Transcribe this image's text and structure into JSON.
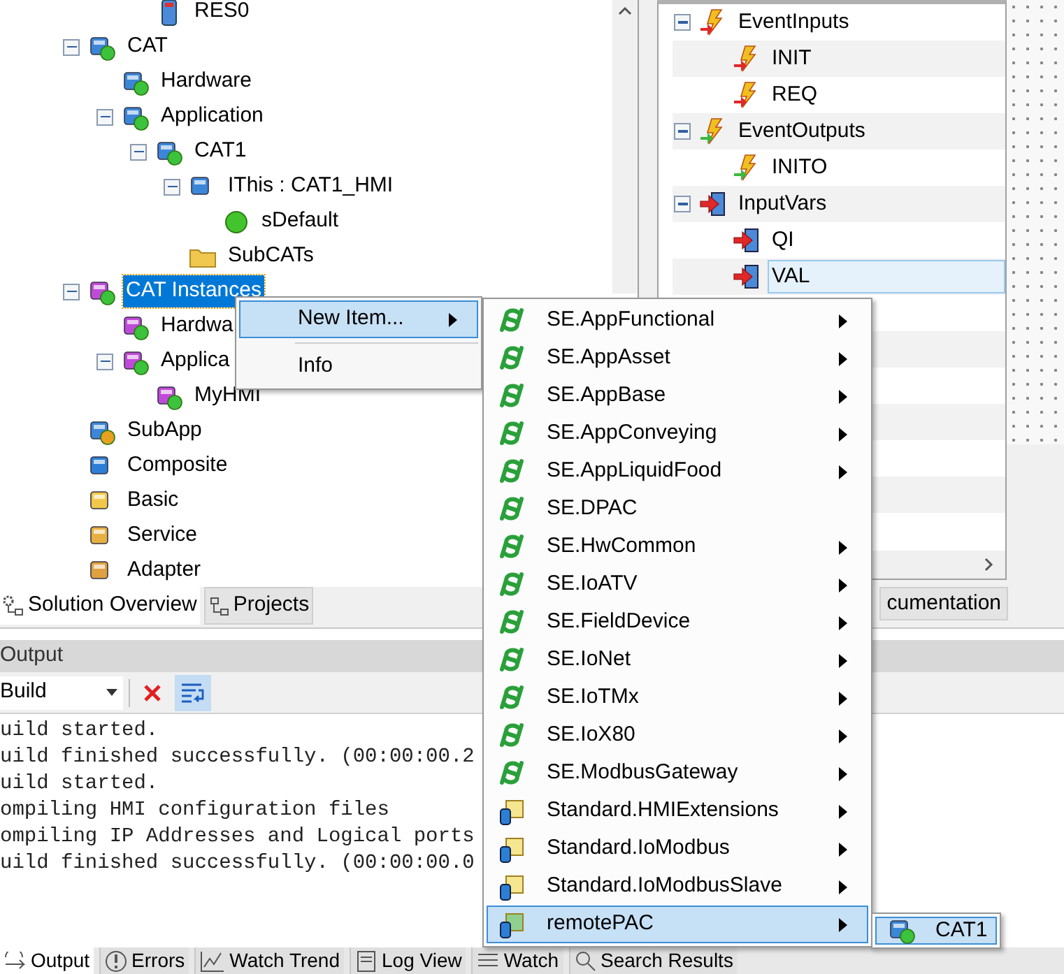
{
  "solution_tree": {
    "scrolled_branch": [
      {
        "label": "RES0",
        "kind": "resource",
        "selected": false
      }
    ],
    "items": [
      {
        "label": "CAT",
        "kind": "cat",
        "expanded": true,
        "selected": false,
        "children": [
          {
            "label": "Hardware",
            "kind": "cat",
            "selected": false
          },
          {
            "label": "Application",
            "kind": "cat",
            "expanded": true,
            "selected": false,
            "children": [
              {
                "label": "CAT1",
                "kind": "cat",
                "expanded": true,
                "selected": false,
                "children": [
                  {
                    "label": "IThis : CAT1_HMI",
                    "kind": "interface",
                    "expanded": true,
                    "selected": false,
                    "children": [
                      {
                        "label": "sDefault",
                        "kind": "module",
                        "selected": false
                      }
                    ]
                  },
                  {
                    "label": "SubCATs",
                    "kind": "folder",
                    "selected": false
                  }
                ]
              }
            ]
          }
        ]
      },
      {
        "label": "CAT Instances",
        "kind": "cat-instance",
        "expanded": true,
        "selected": true,
        "children": [
          {
            "label": "Hardwa",
            "kind": "cat-instance",
            "selected": false
          },
          {
            "label": "Applica",
            "kind": "cat-instance",
            "expanded": true,
            "selected": false,
            "children": [
              {
                "label": "MyHMI",
                "kind": "cat-instance",
                "selected": false
              }
            ]
          }
        ]
      },
      {
        "label": "SubApp",
        "kind": "subapp",
        "selected": false
      },
      {
        "label": "Composite",
        "kind": "composite",
        "selected": false
      },
      {
        "label": "Basic",
        "kind": "basic",
        "selected": false
      },
      {
        "label": "Service",
        "kind": "service",
        "selected": false
      },
      {
        "label": "Adapter",
        "kind": "adapter",
        "selected": false
      }
    ]
  },
  "interface_tree": [
    {
      "label": "EventInputs",
      "kind": "event-in",
      "expanded": true,
      "selected": false,
      "children": [
        {
          "label": "INIT",
          "kind": "event-in",
          "selected": false
        },
        {
          "label": "REQ",
          "kind": "event-in",
          "selected": false
        }
      ]
    },
    {
      "label": "EventOutputs",
      "kind": "event-out",
      "expanded": true,
      "selected": false,
      "children": [
        {
          "label": "INITO",
          "kind": "event-out",
          "selected": false
        }
      ]
    },
    {
      "label": "InputVars",
      "kind": "var-in",
      "expanded": true,
      "selected": false,
      "children": [
        {
          "label": "QI",
          "kind": "var-in",
          "selected": false
        },
        {
          "label": "VAL",
          "kind": "var-in",
          "selected": true
        }
      ]
    }
  ],
  "panel_tabs": [
    {
      "label": "Solution Overview",
      "kind": "solution",
      "selected": true
    },
    {
      "label": "Projects",
      "kind": "projects",
      "selected": false
    }
  ],
  "right_tab": {
    "label": "cumentation"
  },
  "output": {
    "title": "Output",
    "source": "Build",
    "word_wrap_on": true,
    "lines": [
      "uild started.",
      "uild finished successfully. (00:00:00.2",
      "uild started.",
      "ompiling HMI configuration files",
      "ompiling IP Addresses and Logical ports",
      "uild finished successfully. (00:00:00.0"
    ]
  },
  "bottom_tabs": [
    {
      "label": "Output",
      "kind": "output",
      "selected": true
    },
    {
      "label": "Errors",
      "kind": "errors",
      "selected": false
    },
    {
      "label": "Watch Trend",
      "kind": "trend",
      "selected": false
    },
    {
      "label": "Log View",
      "kind": "log",
      "selected": false
    },
    {
      "label": "Watch",
      "kind": "watch",
      "selected": false
    },
    {
      "label": "Search Results",
      "kind": "search",
      "selected": false
    }
  ],
  "context_menu": [
    {
      "label": "New Item...",
      "has_submenu": true,
      "selected": true
    },
    {
      "label": "Info",
      "has_submenu": false,
      "selected": false
    }
  ],
  "submenu": [
    {
      "label": "SE.AppFunctional",
      "kind": "se",
      "has_submenu": true,
      "selected": false
    },
    {
      "label": "SE.AppAsset",
      "kind": "se",
      "has_submenu": true,
      "selected": false
    },
    {
      "label": "SE.AppBase",
      "kind": "se",
      "has_submenu": true,
      "selected": false
    },
    {
      "label": "SE.AppConveying",
      "kind": "se",
      "has_submenu": true,
      "selected": false
    },
    {
      "label": "SE.AppLiquidFood",
      "kind": "se",
      "has_submenu": true,
      "selected": false
    },
    {
      "label": "SE.DPAC",
      "kind": "se",
      "has_submenu": false,
      "selected": false
    },
    {
      "label": "SE.HwCommon",
      "kind": "se",
      "has_submenu": true,
      "selected": false
    },
    {
      "label": "SE.IoATV",
      "kind": "se",
      "has_submenu": true,
      "selected": false
    },
    {
      "label": "SE.FieldDevice",
      "kind": "se",
      "has_submenu": true,
      "selected": false
    },
    {
      "label": "SE.IoNet",
      "kind": "se",
      "has_submenu": true,
      "selected": false
    },
    {
      "label": "SE.IoTMx",
      "kind": "se",
      "has_submenu": true,
      "selected": false
    },
    {
      "label": "SE.IoX80",
      "kind": "se",
      "has_submenu": true,
      "selected": false
    },
    {
      "label": "SE.ModbusGateway",
      "kind": "se",
      "has_submenu": true,
      "selected": false
    },
    {
      "label": "Standard.HMIExtensions",
      "kind": "library",
      "has_submenu": true,
      "selected": false
    },
    {
      "label": "Standard.IoModbus",
      "kind": "library",
      "has_submenu": true,
      "selected": false
    },
    {
      "label": "Standard.IoModbusSlave",
      "kind": "library",
      "has_submenu": true,
      "selected": false
    },
    {
      "label": "remotePAC",
      "kind": "remote",
      "has_submenu": true,
      "selected": true
    }
  ],
  "sub_submenu": [
    {
      "label": "CAT1",
      "kind": "cat",
      "selected": true
    }
  ]
}
